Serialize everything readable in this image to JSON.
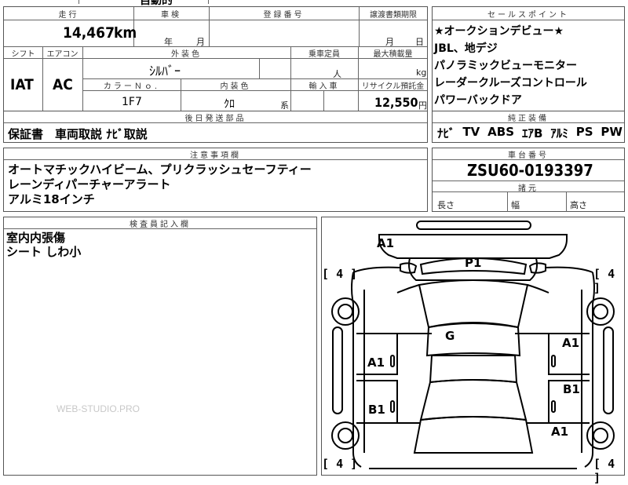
{
  "top_strip": {
    "partial_text": "自動的"
  },
  "mileage": {
    "label": "走行",
    "value": "14,467",
    "unit": "km"
  },
  "shaken": {
    "label": "車検",
    "year_unit": "年",
    "month_unit": "月"
  },
  "registration": {
    "label": "登録番号"
  },
  "transfer": {
    "label": "譲渡書類期限",
    "month_unit": "月",
    "day_unit": "日"
  },
  "shift": {
    "label": "シフト",
    "value": "IAT"
  },
  "aircon": {
    "label": "エアコン",
    "value": "AC"
  },
  "exterior_color": {
    "label": "外装色",
    "value": "ｼﾙﾊﾞｰ"
  },
  "capacity": {
    "label": "乗車定員",
    "unit": "人"
  },
  "max_load": {
    "label": "最大積載量",
    "unit": "kg"
  },
  "color_no": {
    "label": "カラーＮｏ.",
    "value": "1F7"
  },
  "interior_color": {
    "label": "内装色",
    "value": "ｸﾛ",
    "suffix": "系"
  },
  "import": {
    "label": "輸入車"
  },
  "recycle": {
    "label": "リサイクル預託金",
    "value": "12,550",
    "unit": "円"
  },
  "later_parts": {
    "label": "後日発送部品",
    "value": "保証書　車両取説 ﾅﾋﾞ取説"
  },
  "sales_points": {
    "label": "セールスポイント",
    "items": [
      "★オークションデビュー★",
      "JBL、地デジ",
      "パノラミックビューモニター",
      "レーダークルーズコントロール",
      "パワーバックドア"
    ]
  },
  "equipment": {
    "label": "純正装備",
    "items": [
      "ﾅﾋﾞ",
      "TV",
      "ABS",
      "ｴｱB",
      "ｱﾙﾐ",
      "PS",
      "PW"
    ]
  },
  "notes": {
    "label": "注意事項欄",
    "lines": [
      "オートマチックハイビーム、プリクラッシュセーフティー",
      "レーンディパーチャーアラート",
      "アルミ18インチ"
    ]
  },
  "chassis": {
    "label": "車台番号",
    "value": "ZSU60-0193397"
  },
  "dimensions": {
    "label": "諸元",
    "length": "長さ",
    "width": "幅",
    "height": "高さ"
  },
  "inspector": {
    "label": "検査員記入欄",
    "lines": [
      "室内内張傷",
      "シート しわ小"
    ]
  },
  "diagram": {
    "marks": [
      {
        "id": "front-bumper",
        "text": "A1"
      },
      {
        "id": "hood",
        "text": "P1"
      },
      {
        "id": "roof",
        "text": "G"
      },
      {
        "id": "left-front-door",
        "text": "A1"
      },
      {
        "id": "left-rear-door",
        "text": "B1"
      },
      {
        "id": "right-front-door",
        "text": "A1"
      },
      {
        "id": "right-rear-door",
        "text": "B1"
      },
      {
        "id": "right-rear-fender",
        "text": "A1"
      }
    ],
    "tires": [
      {
        "id": "front-left",
        "open": "[",
        "value": "4",
        "close": "]"
      },
      {
        "id": "front-right",
        "open": "[",
        "value": "4",
        "close": "]"
      },
      {
        "id": "rear-left",
        "open": "[",
        "value": "4",
        "close": "]"
      },
      {
        "id": "rear-right",
        "open": "[",
        "value": "4",
        "close": "]"
      }
    ]
  },
  "watermark": "WEB-STUDIO.PRO"
}
